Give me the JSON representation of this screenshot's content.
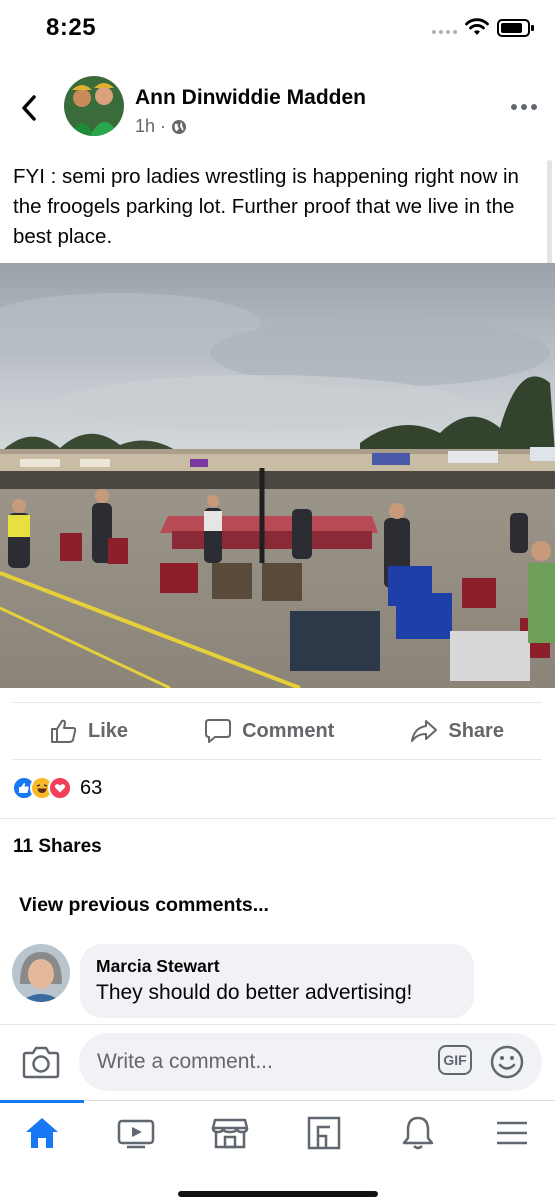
{
  "status_bar": {
    "time": "8:25"
  },
  "post": {
    "author": "Ann Dinwiddie Madden",
    "time_ago": "1h",
    "meta_separator": "·",
    "privacy_icon": "globe-icon",
    "text": "FYI : semi pro ladies wrestling is happening right now in the froogels parking lot. Further proof that we live in the best place."
  },
  "actions": {
    "like_label": "Like",
    "comment_label": "Comment",
    "share_label": "Share"
  },
  "reactions": {
    "types": [
      "like",
      "haha",
      "love"
    ],
    "count": "63"
  },
  "shares_label": "11 Shares",
  "view_previous_label": "View previous comments...",
  "comment": {
    "author": "Marcia Stewart",
    "text": "They should do better advertising!"
  },
  "composer": {
    "placeholder": "Write a comment...",
    "gif_label": "GIF"
  },
  "tabs": [
    {
      "name": "home",
      "icon": "home-icon",
      "active": true
    },
    {
      "name": "watch",
      "icon": "video-icon",
      "active": false
    },
    {
      "name": "marketplace",
      "icon": "store-icon",
      "active": false
    },
    {
      "name": "pages",
      "icon": "pages-icon",
      "active": false
    },
    {
      "name": "notifications",
      "icon": "bell-icon",
      "active": false
    },
    {
      "name": "menu",
      "icon": "menu-icon",
      "active": false
    }
  ],
  "colors": {
    "brand_blue": "#1877f2",
    "secondary_text": "#65676b",
    "love_red": "#f33e58",
    "haha_yellow": "#f7b928"
  }
}
